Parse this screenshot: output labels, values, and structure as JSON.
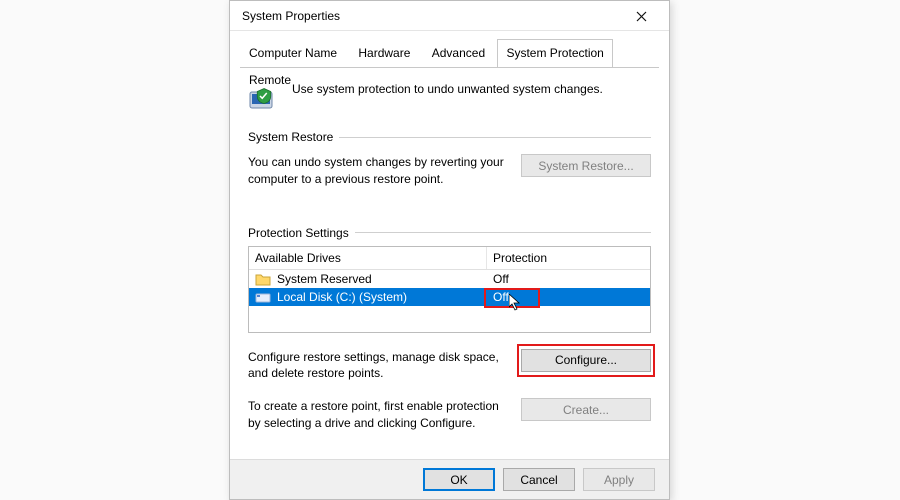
{
  "window": {
    "title": "System Properties"
  },
  "tabs": {
    "items": [
      {
        "label": "Computer Name"
      },
      {
        "label": "Hardware"
      },
      {
        "label": "Advanced"
      },
      {
        "label": "System Protection"
      },
      {
        "label": "Remote"
      }
    ],
    "active_index": 3
  },
  "intro": {
    "text": "Use system protection to undo unwanted system changes."
  },
  "system_restore": {
    "title": "System Restore",
    "desc": "You can undo system changes by reverting your computer to a previous restore point.",
    "button": "System Restore..."
  },
  "protection": {
    "title": "Protection Settings",
    "headers": {
      "drive": "Available Drives",
      "protection": "Protection"
    },
    "rows": [
      {
        "name": "System Reserved",
        "protection": "Off",
        "icon": "folder",
        "selected": false
      },
      {
        "name": "Local Disk (C:) (System)",
        "protection": "Off",
        "icon": "drive",
        "selected": true
      }
    ],
    "configure": {
      "desc": "Configure restore settings, manage disk space, and delete restore points.",
      "button": "Configure..."
    },
    "create": {
      "desc": "To create a restore point, first enable protection by selecting a drive and clicking Configure.",
      "button": "Create..."
    }
  },
  "footer": {
    "ok": "OK",
    "cancel": "Cancel",
    "apply": "Apply"
  }
}
